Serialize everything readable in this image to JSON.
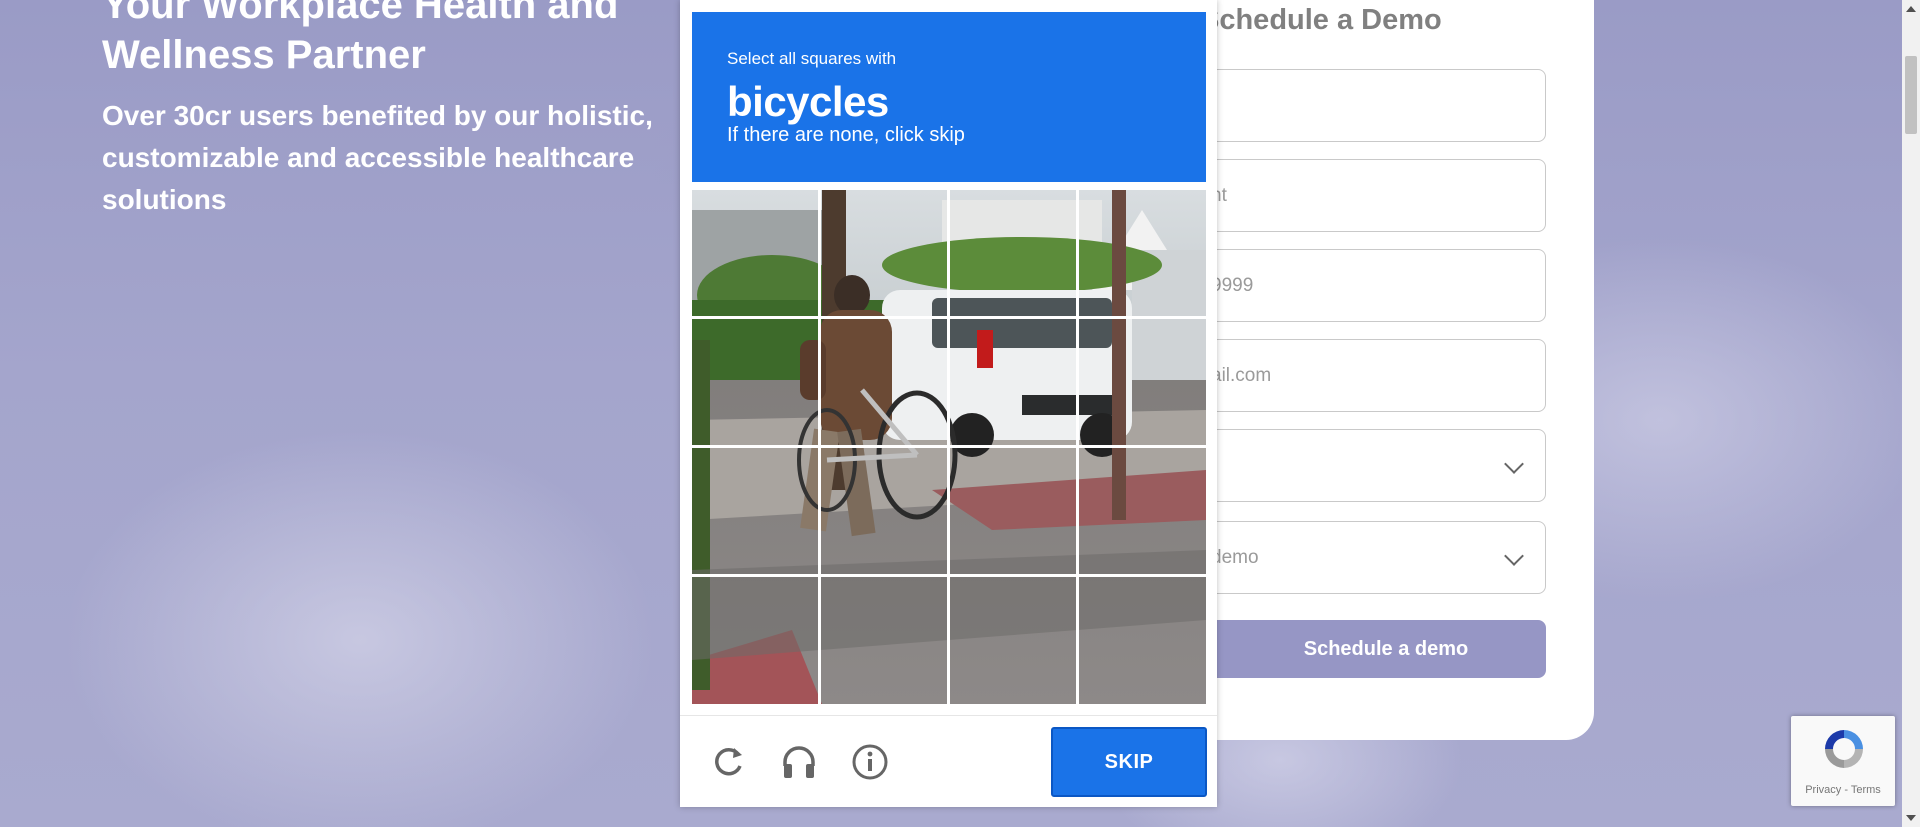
{
  "hero": {
    "title": "Your Workplace Health and Wellness Partner",
    "subtitle": "Over 30cr users benefited by our holistic, customizable and accessible healthcare solutions"
  },
  "form": {
    "title": "Schedule a Demo",
    "fields": [
      {
        "name": "name-field",
        "value": ""
      },
      {
        "name": "company-field",
        "value": "nt"
      },
      {
        "name": "phone-field",
        "value": "9999"
      },
      {
        "name": "email-field",
        "value": "ail.com"
      }
    ],
    "selects": [
      {
        "name": "size-select",
        "value": ")"
      },
      {
        "name": "purpose-select",
        "value": "demo"
      }
    ],
    "submit_label": "Schedule a demo"
  },
  "captcha": {
    "instruction": "Select all squares with",
    "object": "bicycles",
    "hint": "If there are none, click skip",
    "grid_size": 4,
    "skip_label": "SKIP",
    "icons": [
      "reload-icon",
      "audio-icon",
      "info-icon"
    ]
  },
  "recaptcha_badge": {
    "privacy": "Privacy",
    "separator": " - ",
    "terms": "Terms"
  },
  "colors": {
    "accent": "#1a73e8",
    "button": "#9696c5",
    "background": "#a6a6cb"
  }
}
